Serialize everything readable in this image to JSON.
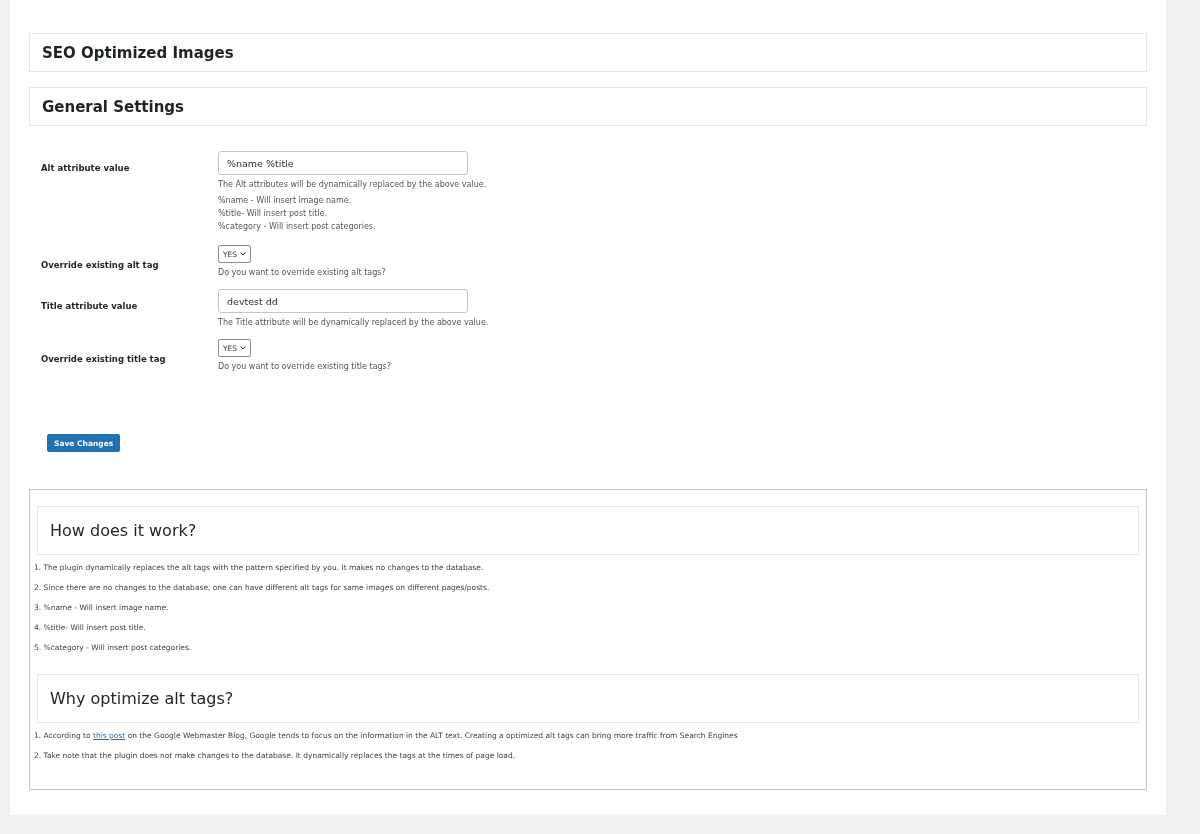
{
  "headers": [
    "SEO Optimized Images",
    "General Settings"
  ],
  "fields": [
    {
      "kind": "text",
      "label": "Alt attribute value",
      "value": "%name %title",
      "help": "The Alt attributes will be dynamically replaced by the above value.",
      "notes": [
        "%name - Will insert image name.",
        "%title- Will insert post title.",
        "%category - Will insert post categories."
      ]
    },
    {
      "kind": "select",
      "label": "Override existing alt tag",
      "value": "YES",
      "help": "Do you want to override existing alt tags?"
    },
    {
      "kind": "text",
      "label": "Title attribute value",
      "value": "devtest dd",
      "help": "The Title attribute will be dynamically replaced by the above value."
    },
    {
      "kind": "select",
      "label": "Override existing title tag",
      "value": "YES",
      "help": "Do you want to override existing title tags?"
    }
  ],
  "save_button": "Save Changes",
  "info_sections": [
    {
      "title": "How does it work?",
      "paragraphs": [
        {
          "text": "1. The plugin dynamically replaces the alt tags with the pattern specified by you. It makes no changes to the database."
        },
        {
          "text": "2. Since there are no changes to the database, one can have different alt tags for same images on different pages/posts."
        },
        {
          "text": "3. %name - Will insert image name."
        },
        {
          "text": "4. %title- Will insert post title."
        },
        {
          "text": "5. %category - Will insert post categories."
        }
      ]
    },
    {
      "title": "Why optimize alt tags?",
      "paragraphs": [
        {
          "text": "1. According to ",
          "link": "this post",
          "after": " on the Google Webmaster Blog, Google tends to focus on the information in the ALT text. Creating a optimized alt tags can bring more traffic from Search Engines"
        },
        {
          "text": "2. Take note that the plugin does not make changes to the database. It dynamically replaces the tags at the times of page load."
        }
      ]
    }
  ]
}
